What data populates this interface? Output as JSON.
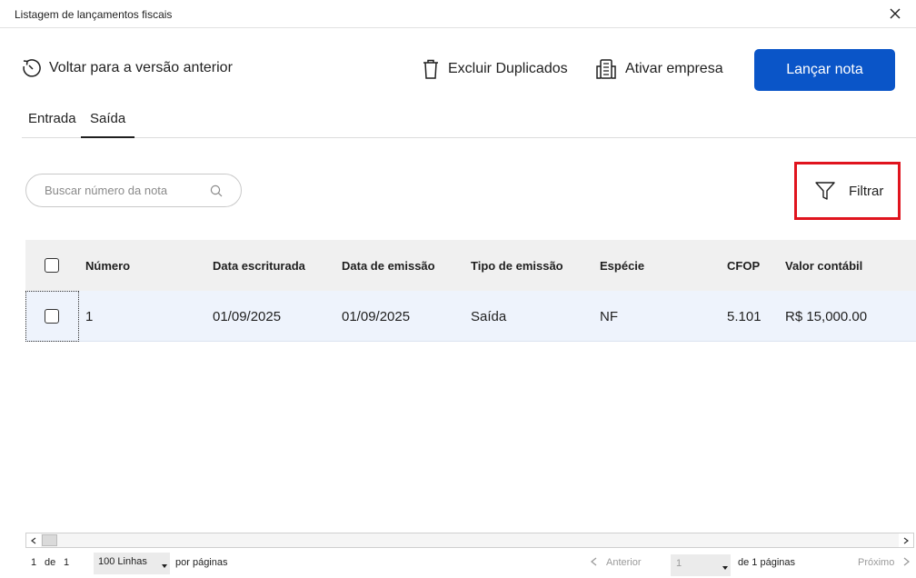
{
  "window": {
    "title": "Listagem de lançamentos fiscais"
  },
  "toolbar": {
    "back_label": "Voltar para a versão anterior",
    "delete_duplicates_label": "Excluir Duplicados",
    "activate_company_label": "Ativar empresa",
    "primary_label": "Lançar nota",
    "primary_color": "#0a55c8"
  },
  "tabs": [
    {
      "label": "Entrada",
      "active": false
    },
    {
      "label": "Saída",
      "active": true
    }
  ],
  "search": {
    "placeholder": "Buscar número da nota",
    "icon": "search-icon"
  },
  "filter": {
    "label": "Filtrar",
    "icon": "filter-icon",
    "highlight_color": "#e0141e"
  },
  "table": {
    "columns": [
      "Número",
      "Data escriturada",
      "Data de emissão",
      "Tipo de emissão",
      "Espécie",
      "CFOP",
      "Valor contábil"
    ],
    "rows": [
      [
        "1",
        "01/09/2025",
        "01/09/2025",
        "Saída",
        "NF",
        "5.101",
        "R$ 15,000.00"
      ]
    ]
  },
  "footer": {
    "range_start": "1",
    "range_of": "de",
    "range_total": "1",
    "lines_value": "100 Linhas",
    "per_pages_label": "por páginas",
    "prev_label": "Anterior",
    "page_value": "1",
    "of_pages_label": "de 1 páginas",
    "next_label": "Próximo"
  }
}
